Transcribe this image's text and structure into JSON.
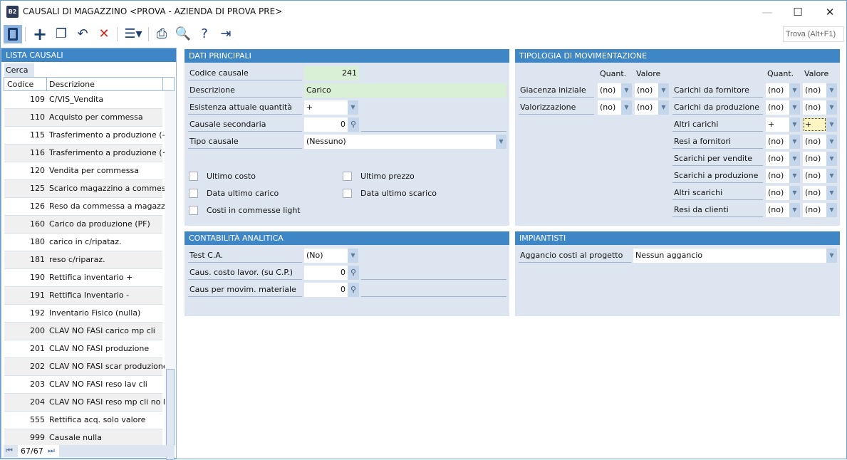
{
  "window": {
    "title": "CAUSALI DI MAGAZZINO <PROVA - AZIENDA DI PROVA PRE>",
    "logo": "B2",
    "min": "—",
    "max": "☐",
    "close": "✕"
  },
  "toolbar": {
    "find": "Trova (Alt+F1)"
  },
  "list": {
    "title": "LISTA CAUSALI",
    "search_label": "Cerca",
    "col_code": "Codice",
    "col_desc": "Descrizione",
    "pager": "67/67",
    "rows": [
      [
        "109",
        "C/VIS_Vendita"
      ],
      [
        "110",
        "Acquisto per commessa"
      ],
      [
        "115",
        "Trasferimento a produzione (-)"
      ],
      [
        "116",
        "Trasferimento a produzione (+)"
      ],
      [
        "120",
        "Vendita per commessa"
      ],
      [
        "125",
        "Scarico magazzino a commessa"
      ],
      [
        "126",
        "Reso da commessa a magazzino"
      ],
      [
        "160",
        "Carico da produzione (PF)"
      ],
      [
        "180",
        "carico in c/ripataz."
      ],
      [
        "181",
        "reso c/riparaz."
      ],
      [
        "190",
        "Rettifica inventario +"
      ],
      [
        "191",
        "Rettifica Inventario -"
      ],
      [
        "192",
        "Inventario Fisico (nulla)"
      ],
      [
        "200",
        "CLAV NO FASI carico mp cli"
      ],
      [
        "201",
        "CLAV NO FASI produzione"
      ],
      [
        "202",
        "CLAV NO FASI scar produzione"
      ],
      [
        "203",
        "CLAV NO FASI reso lav cli"
      ],
      [
        "204",
        "CLAV NO FASI reso mp cli no la"
      ],
      [
        "555",
        "Rettifica acq. solo valore"
      ],
      [
        "999",
        "Causale nulla"
      ]
    ]
  },
  "dati": {
    "title": "DATI PRINCIPALI",
    "codice_label": "Codice causale",
    "codice": "241",
    "descr_label": "Descrizione",
    "descr": "Carico",
    "esist_label": "Esistenza attuale quantità",
    "esist": "+",
    "sec_label": "Causale secondaria",
    "sec": "0",
    "tipo_label": "Tipo causale",
    "tipo": "(Nessuno)",
    "checks": [
      "Ultimo costo",
      "Data ultimo carico",
      "Costi in commesse light",
      "Ultimo prezzo",
      "Data ultimo scarico"
    ]
  },
  "tipologia": {
    "title": "TIPOLOGIA DI MOVIMENTAZIONE",
    "quant": "Quant.",
    "valore": "Valore",
    "left": [
      [
        "Giacenza iniziale",
        "(no)",
        "(no)"
      ],
      [
        "Valorizzazione",
        "(no)",
        "(no)"
      ]
    ],
    "right": [
      [
        "Carichi da fornitore",
        "(no)",
        "(no)"
      ],
      [
        "Carichi da produzione",
        "(no)",
        "(no)"
      ],
      [
        "Altri carichi",
        "+",
        "+"
      ],
      [
        "Resi a fornitori",
        "(no)",
        "(no)"
      ],
      [
        "Scarichi per vendite",
        "(no)",
        "(no)"
      ],
      [
        "Scarichi a produzione",
        "(no)",
        "(no)"
      ],
      [
        "Altri scarichi",
        "(no)",
        "(no)"
      ],
      [
        "Resi da clienti",
        "(no)",
        "(no)"
      ]
    ]
  },
  "ca": {
    "title": "CONTABILITÀ ANALITICA",
    "test_label": "Test C.A.",
    "test": "(No)",
    "lav_label": "Caus. costo lavor. (su C.P.)",
    "lav": "0",
    "mat_label": "Caus per movim. materiale",
    "mat": "0"
  },
  "imp": {
    "title": "IMPIANTISTI",
    "agg_label": "Aggancio costi al progetto",
    "agg": "Nessun aggancio"
  }
}
